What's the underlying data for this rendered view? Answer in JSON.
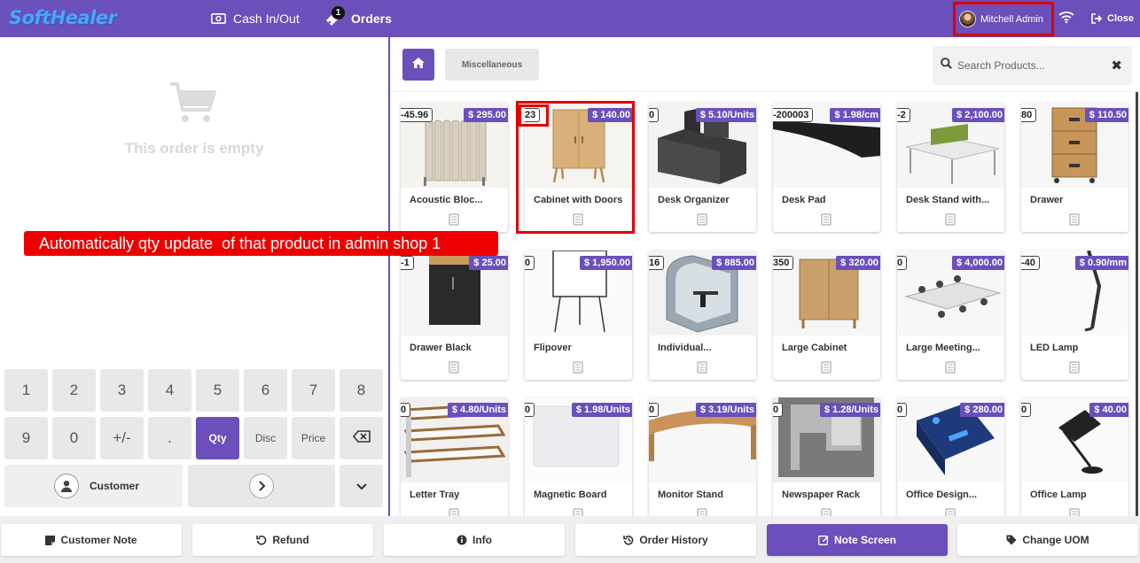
{
  "header": {
    "logo": "SoftHealer",
    "cash_label": "Cash In/Out",
    "orders_label": "Orders",
    "orders_count": "1",
    "user_name": "Mitchell Admin",
    "close_label": "Close"
  },
  "order": {
    "empty_text": "This order is empty"
  },
  "annotation": "Automatically qty update  of that product in admin shop 1",
  "numpad": {
    "keys": [
      "1",
      "2",
      "3",
      "4",
      "5",
      "6",
      "7",
      "8",
      "9",
      "0",
      "+/-",
      ".",
      "Qty",
      "Disc",
      "Price"
    ],
    "customer_label": "Customer"
  },
  "categories": {
    "selected": "Miscellaneous"
  },
  "search": {
    "placeholder": "Search Products..."
  },
  "products": [
    {
      "name": "Acoustic Bloc...",
      "qty": "-45.96",
      "price": "$ 295.00"
    },
    {
      "name": "Cabinet with Doors",
      "qty": "23",
      "price": "$ 140.00"
    },
    {
      "name": "Desk Organizer",
      "qty": "0",
      "price": "$ 5.10/Units"
    },
    {
      "name": "Desk Pad",
      "qty": "-200003",
      "price": "$ 1.98/cm"
    },
    {
      "name": "Desk Stand with...",
      "qty": "-2",
      "price": "$ 2,100.00"
    },
    {
      "name": "Drawer",
      "qty": "80",
      "price": "$ 110.50"
    },
    {
      "name": "Drawer Black",
      "qty": "-1",
      "price": "$ 25.00"
    },
    {
      "name": "Flipover",
      "qty": "0",
      "price": "$ 1,950.00"
    },
    {
      "name": "Individual...",
      "qty": "16",
      "price": "$ 885.00"
    },
    {
      "name": "Large Cabinet",
      "qty": "350",
      "price": "$ 320.00"
    },
    {
      "name": "Large Meeting...",
      "qty": "0",
      "price": "$ 4,000.00"
    },
    {
      "name": "LED Lamp",
      "qty": "-40",
      "price": "$ 0.90/mm"
    },
    {
      "name": "Letter Tray",
      "qty": "0",
      "price": "$ 4.80/Units"
    },
    {
      "name": "Magnetic Board",
      "qty": "0",
      "price": "$ 1.98/Units"
    },
    {
      "name": "Monitor Stand",
      "qty": "0",
      "price": "$ 3.19/Units"
    },
    {
      "name": "Newspaper Rack",
      "qty": "0",
      "price": "$ 1.28/Units"
    },
    {
      "name": "Office Design...",
      "qty": "0",
      "price": "$ 280.00"
    },
    {
      "name": "Office Lamp",
      "qty": "0",
      "price": "$ 40.00"
    }
  ],
  "footer": {
    "customer_note": "Customer Note",
    "refund": "Refund",
    "info": "Info",
    "order_history": "Order History",
    "note_screen": "Note Screen",
    "change_uom": "Change UOM"
  },
  "colors": {
    "brand": "#6b4fbb",
    "highlight": "#e10000"
  }
}
